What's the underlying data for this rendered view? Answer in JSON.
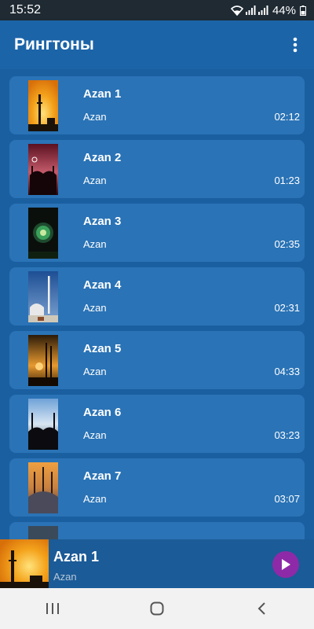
{
  "status_bar": {
    "time": "15:52",
    "battery": "44%",
    "icons": [
      "wifi-icon",
      "signal-icon",
      "signal-icon",
      "battery-icon"
    ]
  },
  "app_bar": {
    "title": "Рингтоны",
    "menu_icon": "more-vert-icon"
  },
  "ringtones": [
    {
      "title": "Azan 1",
      "subtitle": "Azan",
      "duration": "02:12"
    },
    {
      "title": "Azan 2",
      "subtitle": "Azan",
      "duration": "01:23"
    },
    {
      "title": "Azan 3",
      "subtitle": "Azan",
      "duration": "02:35"
    },
    {
      "title": "Azan 4",
      "subtitle": "Azan",
      "duration": "02:31"
    },
    {
      "title": "Azan 5",
      "subtitle": "Azan",
      "duration": "04:33"
    },
    {
      "title": "Azan 6",
      "subtitle": "Azan",
      "duration": "03:23"
    },
    {
      "title": "Azan 7",
      "subtitle": "Azan",
      "duration": "03:07"
    }
  ],
  "player": {
    "title": "Azan 1",
    "subtitle": "Azan",
    "button_icon": "play-icon"
  },
  "nav": {
    "icons": [
      "recent-apps-icon",
      "home-icon",
      "back-icon"
    ]
  },
  "colors": {
    "background": "#1a5fa0",
    "app_bar": "#1c64a8",
    "card": "#2a73b6",
    "play_button": "#8e2aa8",
    "status_bar": "#1f2a33",
    "nav_bar": "#f2f2f2"
  }
}
